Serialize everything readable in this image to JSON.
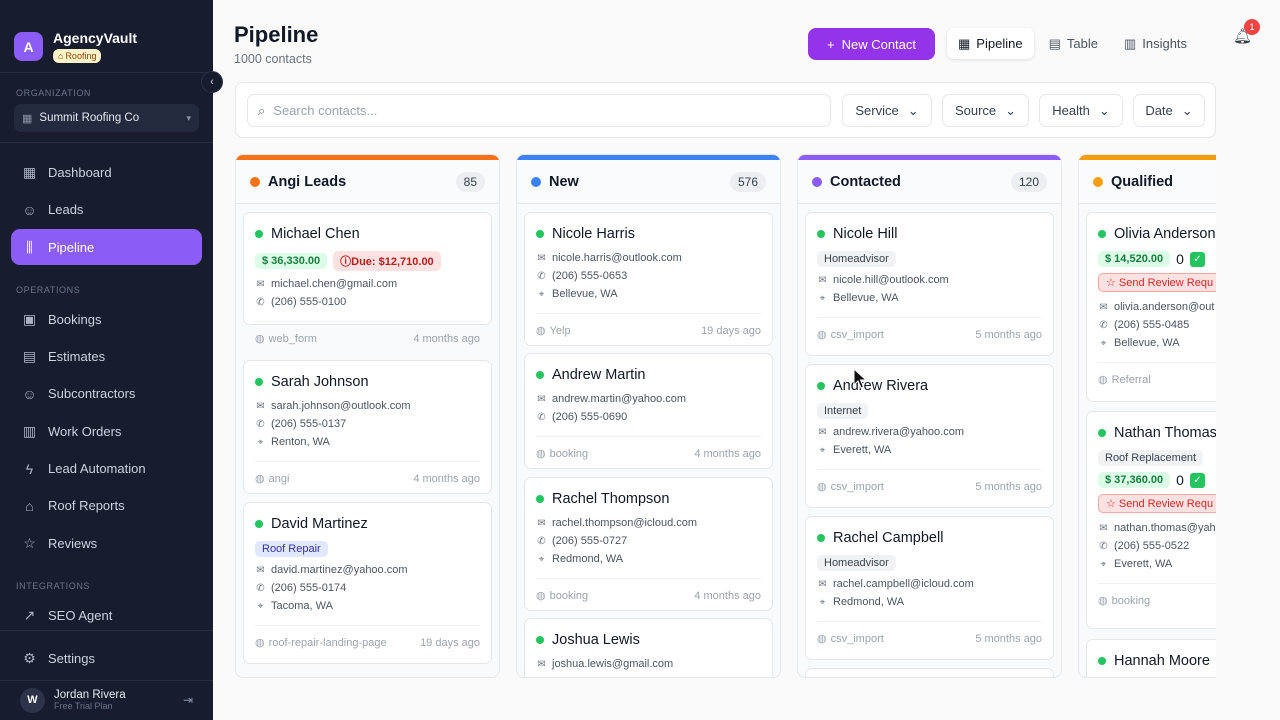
{
  "brand": {
    "initial": "A",
    "name": "AgencyVault",
    "badge": "Roofing"
  },
  "sidebar": {
    "org_label": "ORGANIZATION",
    "org_name": "Summit Roofing Co",
    "main_items": [
      {
        "label": "Dashboard",
        "icon": "grid-icon"
      },
      {
        "label": "Leads",
        "icon": "users-icon"
      },
      {
        "label": "Pipeline",
        "icon": "pipeline-icon",
        "active": true
      }
    ],
    "operations_label": "OPERATIONS",
    "ops_items": [
      {
        "label": "Bookings",
        "icon": "calendar-icon"
      },
      {
        "label": "Estimates",
        "icon": "file-icon"
      },
      {
        "label": "Subcontractors",
        "icon": "users-icon"
      },
      {
        "label": "Work Orders",
        "icon": "clipboard-icon"
      },
      {
        "label": "Lead Automation",
        "icon": "bolt-icon"
      },
      {
        "label": "Roof Reports",
        "icon": "home-icon"
      },
      {
        "label": "Reviews",
        "icon": "star-icon"
      }
    ],
    "integrations_label": "INTEGRATIONS",
    "integration_items": [
      {
        "label": "SEO Agent",
        "icon": "trend-icon"
      }
    ],
    "settings_label": "Settings",
    "user": {
      "initial": "W",
      "name": "Jordan Rivera",
      "plan": "Free Trial Plan"
    }
  },
  "header": {
    "title": "Pipeline",
    "subtitle": "1000 contacts",
    "new_contact": "New Contact",
    "tabs": [
      {
        "label": "Pipeline",
        "active": true
      },
      {
        "label": "Table"
      },
      {
        "label": "Insights"
      }
    ],
    "notification_count": "1"
  },
  "filters": {
    "search_placeholder": "Search contacts...",
    "service": "Service",
    "source": "Source",
    "health": "Health",
    "date": "Date"
  },
  "columns": [
    {
      "title": "Angi Leads",
      "count": "85",
      "color": "#f97316",
      "cards": [
        {
          "name": "Michael Chen",
          "money": "$ 36,330.00",
          "due": "Due: $12,710.00",
          "email": "michael.chen@gmail.com",
          "phone": "(206) 555-0100",
          "source": "web_form",
          "age": "4 months ago"
        },
        {
          "name": "Sarah Johnson",
          "email": "sarah.johnson@outlook.com",
          "phone": "(206) 555-0137",
          "city": "Renton, WA",
          "source": "angi",
          "age": "4 months ago"
        },
        {
          "name": "David Martinez",
          "tag": "Roof Repair",
          "email": "david.martinez@yahoo.com",
          "phone": "(206) 555-0174",
          "city": "Tacoma, WA",
          "source": "roof-repair-landing-page",
          "age": "19 days ago"
        }
      ]
    },
    {
      "title": "New",
      "count": "576",
      "color": "#3b82f6",
      "cards": [
        {
          "name": "Nicole Harris",
          "email": "nicole.harris@outlook.com",
          "phone": "(206) 555-0653",
          "city": "Bellevue, WA",
          "source": "Yelp",
          "age": "19 days ago"
        },
        {
          "name": "Andrew Martin",
          "email": "andrew.martin@yahoo.com",
          "phone": "(206) 555-0690",
          "source": "booking",
          "age": "4 months ago"
        },
        {
          "name": "Rachel Thompson",
          "email": "rachel.thompson@icloud.com",
          "phone": "(206) 555-0727",
          "city": "Redmond, WA",
          "source": "booking",
          "age": "4 months ago"
        },
        {
          "name": "Joshua Lewis",
          "email": "joshua.lewis@gmail.com"
        }
      ]
    },
    {
      "title": "Contacted",
      "count": "120",
      "color": "#8b5cf6",
      "cards": [
        {
          "name": "Nicole Hill",
          "tag": "Homeadvisor",
          "email": "nicole.hill@outlook.com",
          "city": "Bellevue, WA",
          "source": "csv_import",
          "age": "5 months ago"
        },
        {
          "name": "Andrew Rivera",
          "tag": "Internet",
          "email": "andrew.rivera@yahoo.com",
          "city": "Everett, WA",
          "source": "csv_import",
          "age": "5 months ago"
        },
        {
          "name": "Rachel Campbell",
          "tag": "Homeadvisor",
          "email": "rachel.campbell@icloud.com",
          "city": "Redmond, WA",
          "source": "csv_import",
          "age": "5 months ago"
        }
      ]
    },
    {
      "title": "Qualified",
      "color": "#f59e0b",
      "cards": [
        {
          "name": "Olivia Anderson",
          "money": "$ 14,520.00",
          "zero": "0",
          "review": "Send Review Requ",
          "email": "olivia.anderson@out",
          "phone": "(206) 555-0485",
          "city": "Bellevue, WA",
          "source": "Referral"
        },
        {
          "name": "Nathan Thomas",
          "tag": "Roof Replacement",
          "money": "$ 37,360.00",
          "zero": "0",
          "review": "Send Review Requ",
          "email": "nathan.thomas@yah",
          "phone": "(206) 555-0522",
          "city": "Everett, WA",
          "source": "booking"
        },
        {
          "name": "Hannah Moore"
        }
      ]
    }
  ]
}
